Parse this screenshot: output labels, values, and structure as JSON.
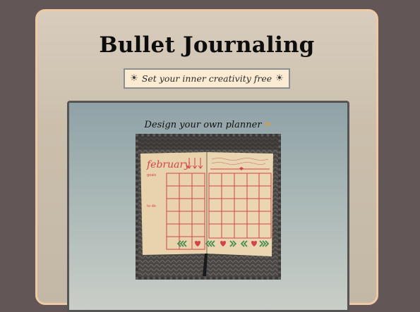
{
  "page": {
    "title": "Bullet Journaling",
    "tagline": {
      "left_icon": "sun-icon",
      "text": "Set your inner creativity free",
      "right_icon": "sun-icon"
    },
    "section": {
      "caption": "Design your own planner",
      "caption_icon": "pencil-icon",
      "image": {
        "name": "open-bullet-journal-photo",
        "page_heading": "february",
        "page_labels": [
          "goals",
          "to do"
        ],
        "right_note": "Man, you lose what you thought, you have everything you need"
      }
    }
  },
  "colors": {
    "background": "#625656",
    "card_border": "#efc9a4",
    "tagline_bg": "#fbebd3",
    "ink_red": "#d4434a",
    "ink_green": "#3e8a4c"
  }
}
